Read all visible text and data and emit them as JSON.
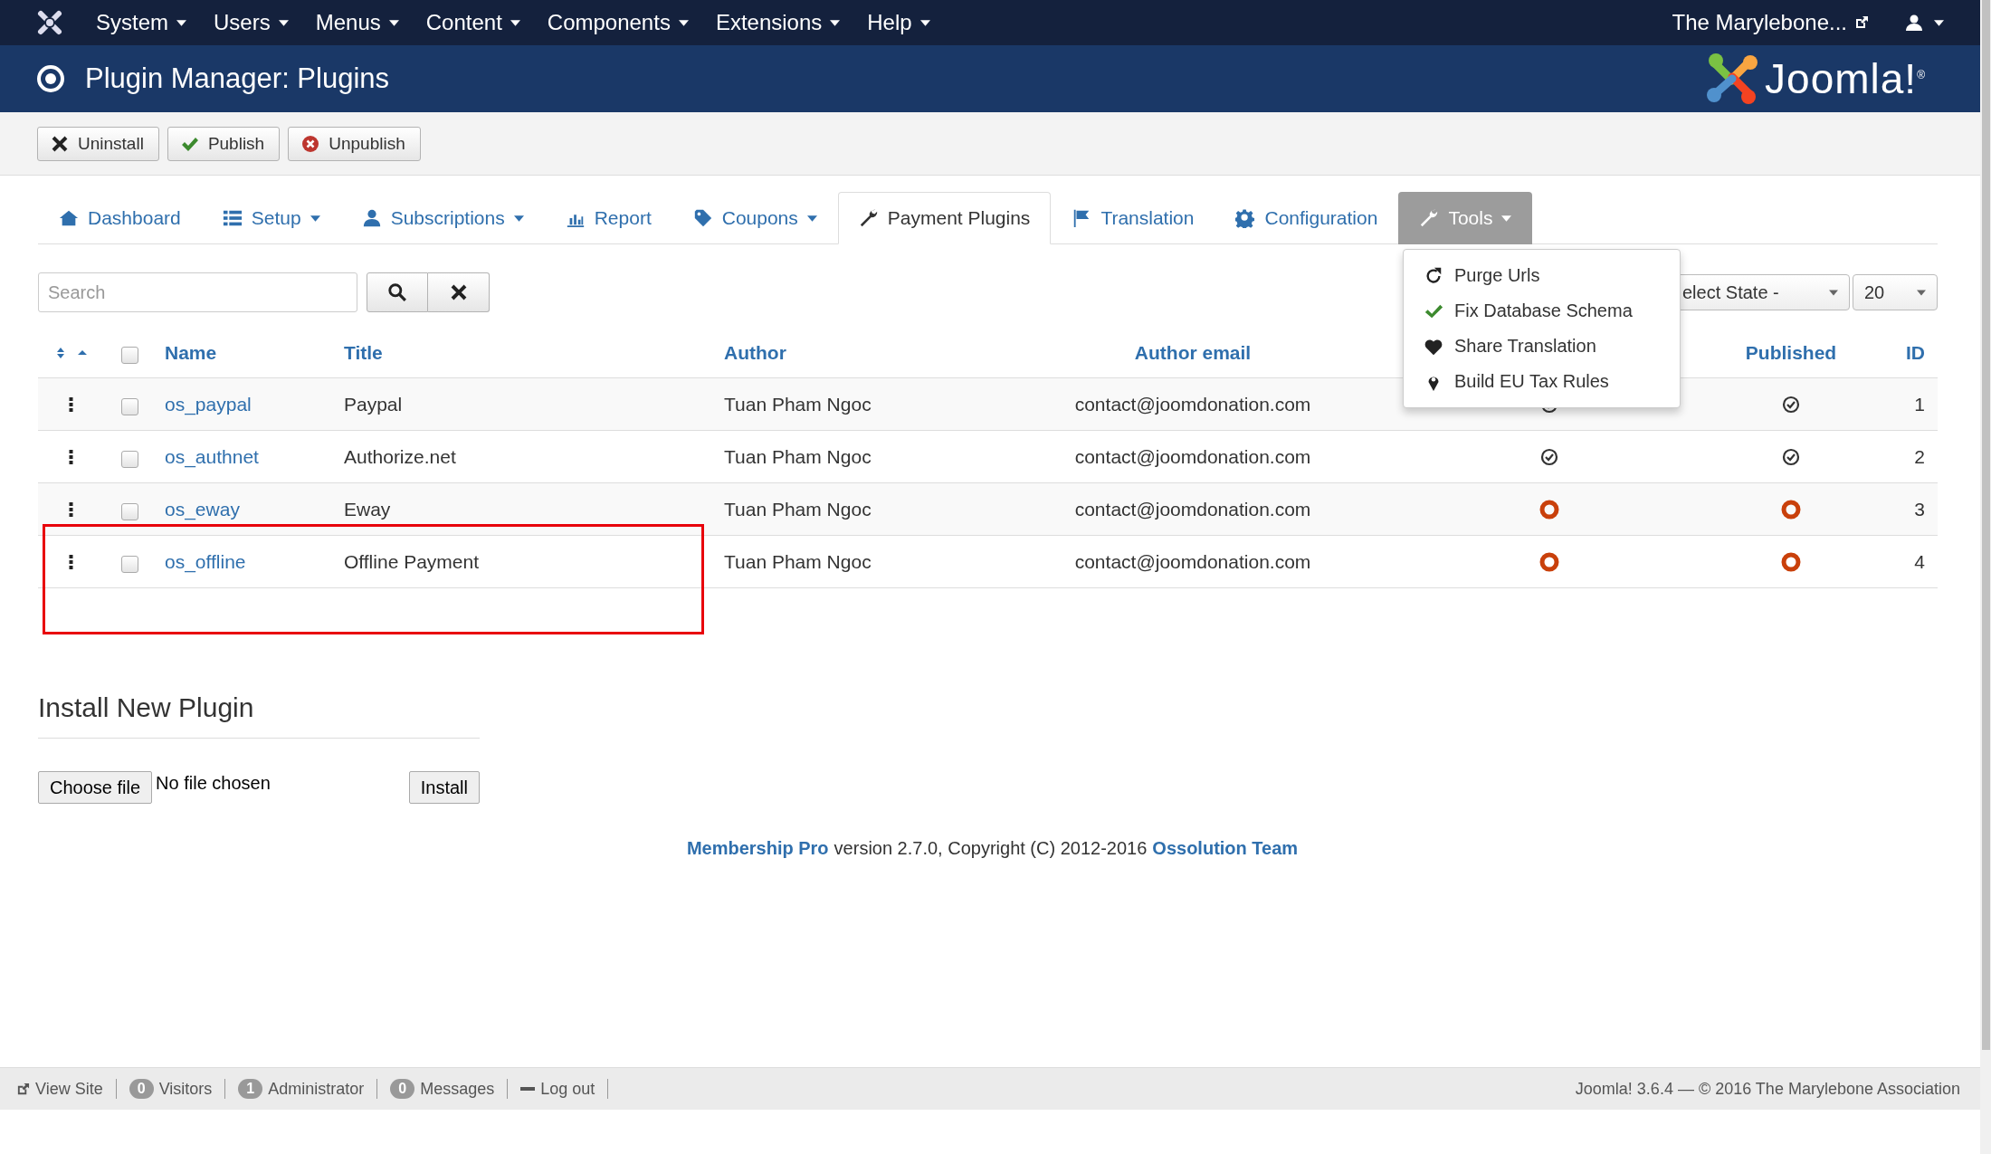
{
  "top_menu": {
    "items": [
      {
        "label": "System"
      },
      {
        "label": "Users"
      },
      {
        "label": "Menus"
      },
      {
        "label": "Content"
      },
      {
        "label": "Components"
      },
      {
        "label": "Extensions"
      },
      {
        "label": "Help"
      }
    ],
    "site_link": "The Marylebone..."
  },
  "header": {
    "title": "Plugin Manager: Plugins",
    "logo_text": "Joomla!$^{®}$"
  },
  "toolbar": [
    {
      "kind": "uninstall",
      "label": "Uninstall"
    },
    {
      "kind": "publish",
      "label": "Publish"
    },
    {
      "kind": "unpublish",
      "label": "Unpublish"
    }
  ],
  "tabs": [
    {
      "kind": "home",
      "label": "Dashboard",
      "caret": false,
      "selected": false,
      "expanded": false
    },
    {
      "kind": "list",
      "label": "Setup",
      "caret": true,
      "selected": false,
      "expanded": false
    },
    {
      "kind": "user",
      "label": "Subscriptions",
      "caret": true,
      "selected": false,
      "expanded": false
    },
    {
      "kind": "chart",
      "label": "Report",
      "caret": false,
      "selected": false,
      "expanded": false
    },
    {
      "kind": "tag",
      "label": "Coupons",
      "caret": true,
      "selected": false,
      "expanded": false
    },
    {
      "kind": "wrench",
      "label": "Payment Plugins",
      "caret": false,
      "selected": true,
      "expanded": false
    },
    {
      "kind": "flag",
      "label": "Translation",
      "caret": false,
      "selected": false,
      "expanded": false
    },
    {
      "kind": "gear",
      "label": "Configuration",
      "caret": false,
      "selected": false,
      "expanded": false
    },
    {
      "kind": "wrench",
      "label": "Tools",
      "caret": true,
      "selected": false,
      "expanded": true
    }
  ],
  "tools_menu": [
    {
      "kind": "refresh",
      "label": "Purge Urls"
    },
    {
      "kind": "check",
      "label": "Fix Database Schema"
    },
    {
      "kind": "heart",
      "label": "Share Translation"
    },
    {
      "kind": "pin",
      "label": "Build EU Tax Rules"
    }
  ],
  "search": {
    "placeholder": "Search"
  },
  "filters": {
    "state": "elect State -",
    "limit": "20"
  },
  "table": {
    "select_all_checked": false,
    "columns": {
      "name": "Name",
      "title": "Title",
      "author": "Author",
      "author_email": "Author email",
      "published": "Published",
      "id": "ID"
    },
    "rows": [
      {
        "name": "os_paypal",
        "title": "Paypal",
        "author": "Tuan Pham Ngoc",
        "author_email": "contact@joomdonation.com",
        "column_5": true,
        "published": true,
        "id": "1",
        "checked": false
      },
      {
        "name": "os_authnet",
        "title": "Authorize.net",
        "author": "Tuan Pham Ngoc",
        "author_email": "contact@joomdonation.com",
        "column_5": true,
        "published": true,
        "id": "2",
        "checked": false
      },
      {
        "name": "os_eway",
        "title": "Eway",
        "author": "Tuan Pham Ngoc",
        "author_email": "contact@joomdonation.com",
        "column_5": false,
        "published": false,
        "id": "3",
        "checked": false
      },
      {
        "name": "os_offline",
        "title": "Offline Payment",
        "author": "Tuan Pham Ngoc",
        "author_email": "contact@joomdonation.com",
        "column_5": false,
        "published": false,
        "id": "4",
        "checked": false,
        "highlighted": true
      }
    ]
  },
  "install": {
    "heading": "Install New Plugin",
    "choose_button": "Choose file",
    "file_status": "No file chosen",
    "install_button": "Install"
  },
  "credit": {
    "product": "Membership Pro",
    "text": "version 2.7.0, Copyright (C) 2012-2016",
    "team": "Ossolution Team"
  },
  "status_bar": {
    "items": [
      {
        "kind": "link",
        "label": "View Site"
      },
      {
        "kind": "count",
        "count": "0",
        "label": "Visitors"
      },
      {
        "kind": "count",
        "count": "1",
        "label": "Administrator"
      },
      {
        "kind": "count",
        "count": "0",
        "label": "Messages"
      },
      {
        "kind": "logout",
        "label": "Log out"
      }
    ],
    "version": "Joomla! 3.6.4  —  © 2016 The Marylebone Association"
  }
}
